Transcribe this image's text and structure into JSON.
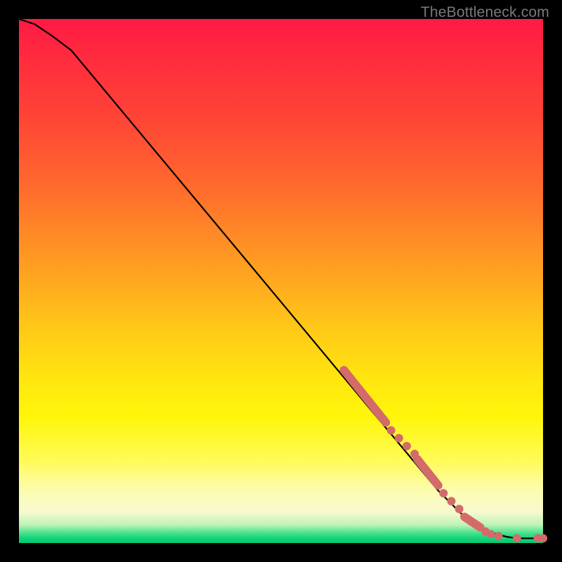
{
  "watermark": "TheBottleneck.com",
  "colors": {
    "frame": "#000000",
    "marker": "#d46a6a",
    "curve": "#000000",
    "gradient_stops": [
      "#ff1a45",
      "#ff6a2d",
      "#ffe40f",
      "#fcfcb0",
      "#00c96f"
    ]
  },
  "chart_data": {
    "type": "line",
    "title": "",
    "xlabel": "",
    "ylabel": "",
    "xlim": [
      0,
      100
    ],
    "ylim": [
      0,
      100
    ],
    "series": [
      {
        "name": "bottleneck-curve",
        "x": [
          0,
          3,
          6,
          10,
          20,
          30,
          40,
          50,
          60,
          70,
          80,
          85,
          90,
          93,
          95,
          97,
          99,
          100
        ],
        "y": [
          100,
          99,
          97,
          94,
          82,
          70,
          58,
          46,
          34,
          22,
          10,
          5,
          2,
          1.2,
          0.9,
          0.9,
          0.9,
          0.9
        ]
      }
    ],
    "markers": [
      {
        "name": "segment-upper",
        "kind": "capsule",
        "x1": 62,
        "y1": 33,
        "x2": 70,
        "y2": 23
      },
      {
        "name": "points-mid",
        "kind": "dots",
        "points": [
          {
            "x": 71,
            "y": 21.5
          },
          {
            "x": 72.5,
            "y": 20
          },
          {
            "x": 74,
            "y": 18.5
          },
          {
            "x": 75.5,
            "y": 17
          }
        ]
      },
      {
        "name": "segment-mid",
        "kind": "capsule",
        "x1": 76,
        "y1": 16,
        "x2": 80,
        "y2": 11
      },
      {
        "name": "points-lower",
        "kind": "dots",
        "points": [
          {
            "x": 81,
            "y": 9.5
          },
          {
            "x": 82.5,
            "y": 8
          },
          {
            "x": 84,
            "y": 6.5
          }
        ]
      },
      {
        "name": "segment-lower",
        "kind": "capsule",
        "x1": 85,
        "y1": 5,
        "x2": 88,
        "y2": 3
      },
      {
        "name": "points-tail",
        "kind": "dots",
        "points": [
          {
            "x": 89,
            "y": 2.2
          },
          {
            "x": 90,
            "y": 1.7
          },
          {
            "x": 91.5,
            "y": 1.3
          },
          {
            "x": 95,
            "y": 0.9
          },
          {
            "x": 99,
            "y": 0.9
          },
          {
            "x": 100,
            "y": 0.9
          }
        ]
      }
    ]
  }
}
